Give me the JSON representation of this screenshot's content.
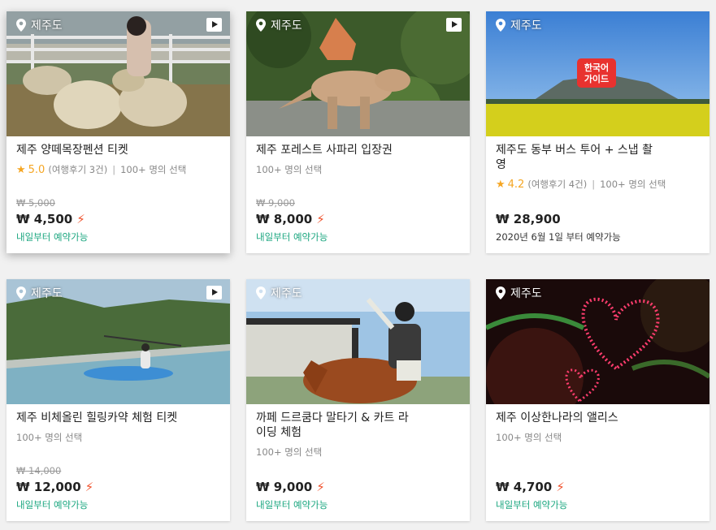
{
  "cards": [
    {
      "location": "제주도",
      "has_video": true,
      "title": "제주 양떼목장펜션 티켓",
      "rating": "5.0",
      "reviews": "(여행후기 3건)",
      "selections": "100+ 명의 선택",
      "original_price": "₩ 5,000",
      "price": "₩ 4,500",
      "instant": true,
      "availability": "내일부터 예약가능"
    },
    {
      "location": "제주도",
      "has_video": true,
      "title": "제주 포레스트 사파리 입장권",
      "selections": "100+ 명의 선택",
      "original_price": "₩ 9,000",
      "price": "₩ 8,000",
      "instant": true,
      "availability": "내일부터 예약가능"
    },
    {
      "location": "제주도",
      "has_video": false,
      "badge_text": "한국어\n가이드",
      "title": "제주도 동부 버스 투어 + 스냅 촬영",
      "rating": "4.2",
      "reviews": "(여행후기 4건)",
      "selections": "100+ 명의 선택",
      "price": "₩ 28,900",
      "instant": false,
      "availability": "2020년 6월 1일 부터 예약가능"
    },
    {
      "location": "제주도",
      "has_video": true,
      "title": "제주 비체올린 힐링카약 체험 티켓",
      "selections": "100+ 명의 선택",
      "original_price": "₩ 14,000",
      "price": "₩ 12,000",
      "instant": true,
      "availability": "내일부터 예약가능"
    },
    {
      "location": "제주도",
      "has_video": false,
      "title": "까페 드르쿰다 말타기 & 카트 라이딩 체험",
      "selections": "100+ 명의 선택",
      "price": "₩ 9,000",
      "instant": true,
      "availability": "내일부터 예약가능"
    },
    {
      "location": "제주도",
      "has_video": false,
      "title": "제주 이상한나라의 앨리스",
      "selections": "100+ 명의 선택",
      "price": "₩ 4,700",
      "instant": true,
      "availability": "내일부터 예약가능"
    }
  ],
  "icons": {
    "location": "map-pin-icon",
    "video": "video-play-icon",
    "instant": "lightning-bolt-icon",
    "star": "star-icon"
  },
  "colors": {
    "availability": "#1aa67f",
    "instant": "#f0512b",
    "star": "#f5a623"
  }
}
